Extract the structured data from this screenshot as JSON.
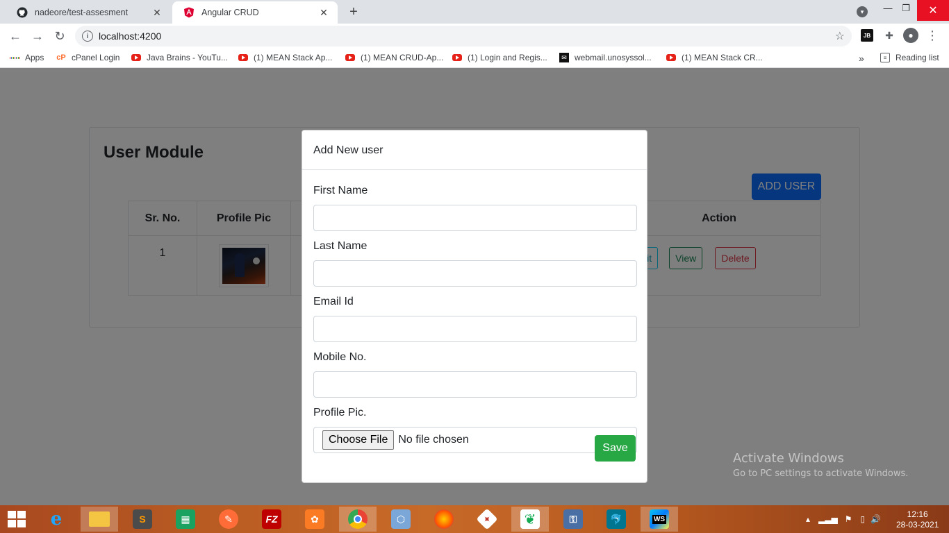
{
  "browser": {
    "tabs": [
      {
        "title": "nadeore/test-assesment",
        "active": false,
        "icon": "github-icon"
      },
      {
        "title": "Angular CRUD",
        "active": true,
        "icon": "angular-icon"
      }
    ],
    "address": "localhost:4200",
    "bookmarks": [
      {
        "label": "Apps",
        "icon": "apps-grid-icon"
      },
      {
        "label": "cPanel Login",
        "icon": "cpanel-icon"
      },
      {
        "label": "Java Brains - YouTu...",
        "icon": "youtube-icon"
      },
      {
        "label": "(1) MEAN Stack Ap...",
        "icon": "youtube-icon"
      },
      {
        "label": "(1) MEAN CRUD-Ap...",
        "icon": "youtube-icon"
      },
      {
        "label": "(1) Login and Regis...",
        "icon": "youtube-icon"
      },
      {
        "label": "webmail.unosyssol...",
        "icon": "webmail-icon"
      },
      {
        "label": "(1) MEAN Stack CR...",
        "icon": "youtube-icon"
      }
    ],
    "reading_list": "Reading list",
    "jb_badge": "JB"
  },
  "page": {
    "title": "User Module",
    "add_user_label": "ADD USER",
    "table": {
      "headers": [
        "Sr. No.",
        "Profile Pic",
        "Action"
      ],
      "rows": [
        {
          "sr": "1",
          "actions": [
            "Edit",
            "View",
            "Delete"
          ]
        }
      ]
    }
  },
  "modal": {
    "title": "Add New user",
    "fields": {
      "first_name": "First Name",
      "last_name": "Last Name",
      "email": "Email Id",
      "mobile": "Mobile No.",
      "profile_pic": "Profile Pic."
    },
    "choose_file": "Choose File",
    "no_file": "No file chosen",
    "save": "Save"
  },
  "watermark": {
    "line1": "Activate Windows",
    "line2": "Go to PC settings to activate Windows."
  },
  "taskbar": {
    "time": "12:16",
    "date": "28-03-2021"
  },
  "colors": {
    "primary": "#0d6efd",
    "success": "#28a745",
    "danger": "#dc3545",
    "info": "#0dcaf0",
    "close_red": "#e81123"
  }
}
